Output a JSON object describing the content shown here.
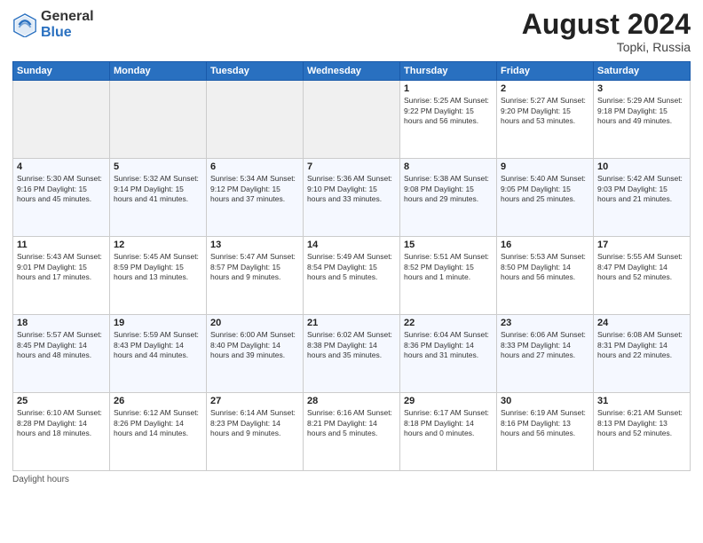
{
  "header": {
    "logo_general": "General",
    "logo_blue": "Blue",
    "month_year": "August 2024",
    "location": "Topki, Russia"
  },
  "days_of_week": [
    "Sunday",
    "Monday",
    "Tuesday",
    "Wednesday",
    "Thursday",
    "Friday",
    "Saturday"
  ],
  "footer": "Daylight hours",
  "weeks": [
    [
      {
        "day": "",
        "info": ""
      },
      {
        "day": "",
        "info": ""
      },
      {
        "day": "",
        "info": ""
      },
      {
        "day": "",
        "info": ""
      },
      {
        "day": "1",
        "info": "Sunrise: 5:25 AM\nSunset: 9:22 PM\nDaylight: 15 hours\nand 56 minutes."
      },
      {
        "day": "2",
        "info": "Sunrise: 5:27 AM\nSunset: 9:20 PM\nDaylight: 15 hours\nand 53 minutes."
      },
      {
        "day": "3",
        "info": "Sunrise: 5:29 AM\nSunset: 9:18 PM\nDaylight: 15 hours\nand 49 minutes."
      }
    ],
    [
      {
        "day": "4",
        "info": "Sunrise: 5:30 AM\nSunset: 9:16 PM\nDaylight: 15 hours\nand 45 minutes."
      },
      {
        "day": "5",
        "info": "Sunrise: 5:32 AM\nSunset: 9:14 PM\nDaylight: 15 hours\nand 41 minutes."
      },
      {
        "day": "6",
        "info": "Sunrise: 5:34 AM\nSunset: 9:12 PM\nDaylight: 15 hours\nand 37 minutes."
      },
      {
        "day": "7",
        "info": "Sunrise: 5:36 AM\nSunset: 9:10 PM\nDaylight: 15 hours\nand 33 minutes."
      },
      {
        "day": "8",
        "info": "Sunrise: 5:38 AM\nSunset: 9:08 PM\nDaylight: 15 hours\nand 29 minutes."
      },
      {
        "day": "9",
        "info": "Sunrise: 5:40 AM\nSunset: 9:05 PM\nDaylight: 15 hours\nand 25 minutes."
      },
      {
        "day": "10",
        "info": "Sunrise: 5:42 AM\nSunset: 9:03 PM\nDaylight: 15 hours\nand 21 minutes."
      }
    ],
    [
      {
        "day": "11",
        "info": "Sunrise: 5:43 AM\nSunset: 9:01 PM\nDaylight: 15 hours\nand 17 minutes."
      },
      {
        "day": "12",
        "info": "Sunrise: 5:45 AM\nSunset: 8:59 PM\nDaylight: 15 hours\nand 13 minutes."
      },
      {
        "day": "13",
        "info": "Sunrise: 5:47 AM\nSunset: 8:57 PM\nDaylight: 15 hours\nand 9 minutes."
      },
      {
        "day": "14",
        "info": "Sunrise: 5:49 AM\nSunset: 8:54 PM\nDaylight: 15 hours\nand 5 minutes."
      },
      {
        "day": "15",
        "info": "Sunrise: 5:51 AM\nSunset: 8:52 PM\nDaylight: 15 hours\nand 1 minute."
      },
      {
        "day": "16",
        "info": "Sunrise: 5:53 AM\nSunset: 8:50 PM\nDaylight: 14 hours\nand 56 minutes."
      },
      {
        "day": "17",
        "info": "Sunrise: 5:55 AM\nSunset: 8:47 PM\nDaylight: 14 hours\nand 52 minutes."
      }
    ],
    [
      {
        "day": "18",
        "info": "Sunrise: 5:57 AM\nSunset: 8:45 PM\nDaylight: 14 hours\nand 48 minutes."
      },
      {
        "day": "19",
        "info": "Sunrise: 5:59 AM\nSunset: 8:43 PM\nDaylight: 14 hours\nand 44 minutes."
      },
      {
        "day": "20",
        "info": "Sunrise: 6:00 AM\nSunset: 8:40 PM\nDaylight: 14 hours\nand 39 minutes."
      },
      {
        "day": "21",
        "info": "Sunrise: 6:02 AM\nSunset: 8:38 PM\nDaylight: 14 hours\nand 35 minutes."
      },
      {
        "day": "22",
        "info": "Sunrise: 6:04 AM\nSunset: 8:36 PM\nDaylight: 14 hours\nand 31 minutes."
      },
      {
        "day": "23",
        "info": "Sunrise: 6:06 AM\nSunset: 8:33 PM\nDaylight: 14 hours\nand 27 minutes."
      },
      {
        "day": "24",
        "info": "Sunrise: 6:08 AM\nSunset: 8:31 PM\nDaylight: 14 hours\nand 22 minutes."
      }
    ],
    [
      {
        "day": "25",
        "info": "Sunrise: 6:10 AM\nSunset: 8:28 PM\nDaylight: 14 hours\nand 18 minutes."
      },
      {
        "day": "26",
        "info": "Sunrise: 6:12 AM\nSunset: 8:26 PM\nDaylight: 14 hours\nand 14 minutes."
      },
      {
        "day": "27",
        "info": "Sunrise: 6:14 AM\nSunset: 8:23 PM\nDaylight: 14 hours\nand 9 minutes."
      },
      {
        "day": "28",
        "info": "Sunrise: 6:16 AM\nSunset: 8:21 PM\nDaylight: 14 hours\nand 5 minutes."
      },
      {
        "day": "29",
        "info": "Sunrise: 6:17 AM\nSunset: 8:18 PM\nDaylight: 14 hours\nand 0 minutes."
      },
      {
        "day": "30",
        "info": "Sunrise: 6:19 AM\nSunset: 8:16 PM\nDaylight: 13 hours\nand 56 minutes."
      },
      {
        "day": "31",
        "info": "Sunrise: 6:21 AM\nSunset: 8:13 PM\nDaylight: 13 hours\nand 52 minutes."
      }
    ]
  ]
}
